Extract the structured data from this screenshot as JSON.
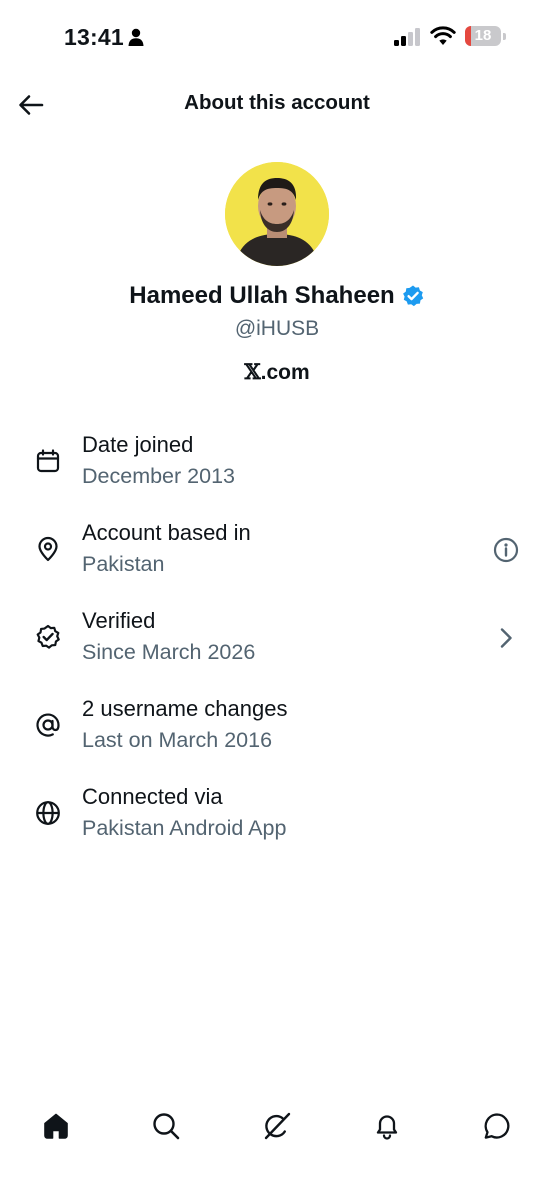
{
  "status_bar": {
    "time": "13:41",
    "battery_level": "18",
    "battery_fraction": 0.18,
    "colors": {
      "battery_low": "#e5483f"
    },
    "icons": [
      "person-icon",
      "signal-icon",
      "wifi-icon",
      "battery-icon"
    ]
  },
  "header": {
    "title": "About this account",
    "back_icon": "arrow-left-icon"
  },
  "profile": {
    "display_name": "Hameed Ullah Shaheen",
    "handle": "@iHUSB",
    "source_mark": "𝕏",
    "source_domain": ".com",
    "verified_icon": "verified-badge-icon",
    "colors": {
      "verified": "#1d9bf0",
      "avatar_bg": "#f2e24a"
    }
  },
  "details": [
    {
      "icon": "calendar-icon",
      "title": "Date joined",
      "subtitle": "December 2013"
    },
    {
      "icon": "location-pin-icon",
      "title": "Account based in",
      "subtitle": "Pakistan",
      "trailing": "info-icon"
    },
    {
      "icon": "verified-outline-icon",
      "title": "Verified",
      "subtitle": "Since March 2026",
      "trailing": "chevron-right-icon"
    },
    {
      "icon": "at-sign-icon",
      "title": "2 username changes",
      "subtitle": "Last on March 2016"
    },
    {
      "icon": "globe-icon",
      "title": "Connected via",
      "subtitle": "Pakistan Android App"
    }
  ],
  "tab_bar": {
    "tabs": [
      "home-icon",
      "search-icon",
      "grok-icon",
      "notifications-icon",
      "messages-icon"
    ]
  },
  "colors": {
    "text": "#0f1419",
    "secondary_text": "#536471",
    "background": "#ffffff"
  }
}
